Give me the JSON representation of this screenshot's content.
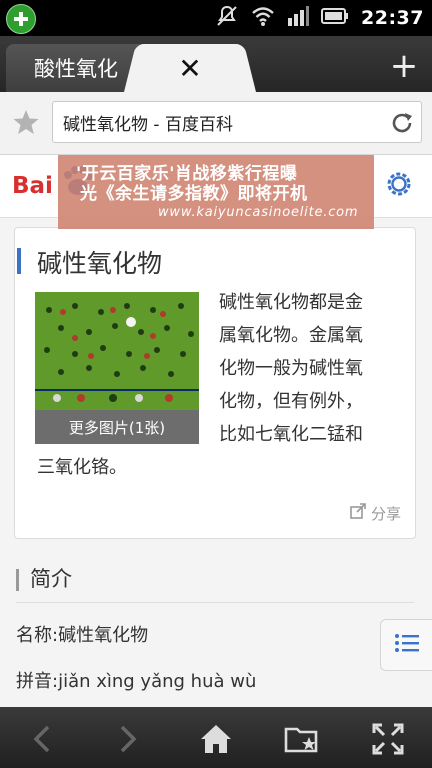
{
  "status_bar": {
    "time": "22:37",
    "icons": [
      "app-plus-icon",
      "mute-icon",
      "wifi-icon",
      "signal-icon",
      "battery-icon"
    ]
  },
  "tabs": {
    "inactive_label": "酸性氧化",
    "active_close": "✕",
    "new_tab": "+"
  },
  "url_bar": {
    "value": "碱性氧化物 - 百度百科"
  },
  "header": {
    "logo": "Bai",
    "watermark_line1": "'开云百家乐'肖战移紫行程曝",
    "watermark_line2": "光《余生请多指教》即将开机",
    "watermark_url": "www.kaiyuncasinoelite.com"
  },
  "article": {
    "title": "碱性氧化物",
    "image_caption": "更多图片(1张)",
    "summary_lines": [
      "碱性氧化物都是金",
      "属氧化物。金属氧",
      "化物一般为碱性氧",
      "化物，但有例外，",
      "比如七氧化二锰和"
    ],
    "summary_last_line": "三氧化铬。",
    "share_label": "分享"
  },
  "intro": {
    "section_title": "简介",
    "name_line": "名称:碱性氧化物",
    "pinyin_line": "拼音:jiǎn xìng yǎng huà wù"
  },
  "colors": {
    "accent_blue": "#3b73c8",
    "baidu_red": "#d82f2f",
    "baidu_blue": "#2b59c3",
    "watermark_bg": "#ce826e"
  }
}
